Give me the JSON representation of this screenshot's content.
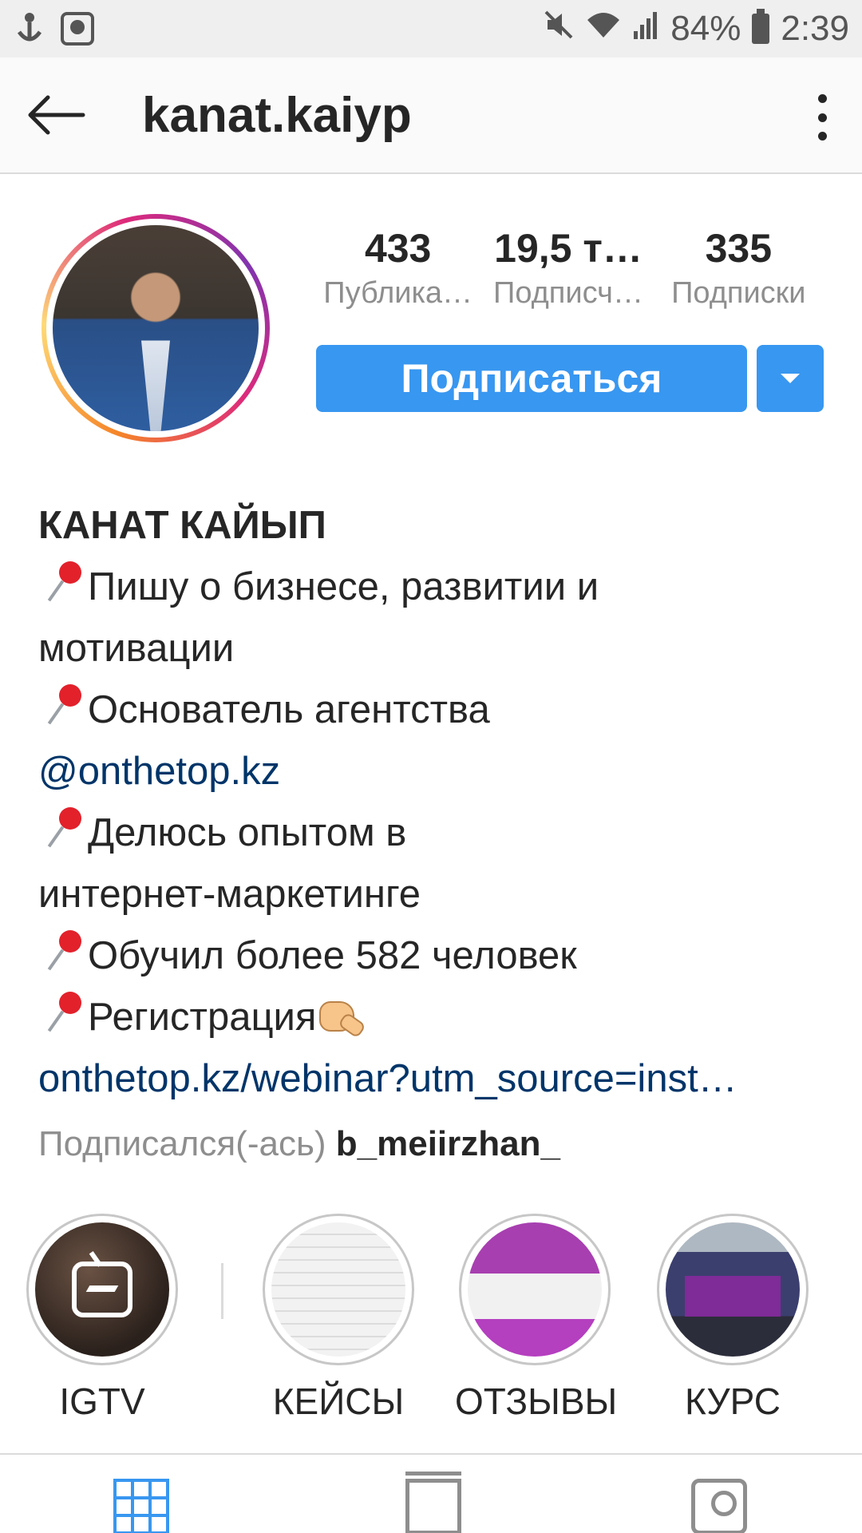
{
  "status_bar": {
    "battery": "84%",
    "time": "2:39",
    "icons": [
      "anchor-icon",
      "download-icon",
      "mute-icon",
      "wifi-icon",
      "signal-icon",
      "battery-icon"
    ]
  },
  "header": {
    "username": "kanat.kaiyp"
  },
  "stats": {
    "posts_value": "433",
    "posts_label": "Публика…",
    "followers_value": "19,5 т…",
    "followers_label": "Подписч…",
    "following_value": "335",
    "following_label": "Подписки"
  },
  "actions": {
    "follow_label": "Подписаться"
  },
  "bio": {
    "full_name": "КАНАТ КАЙЫП",
    "line1": "Пишу о бизнесе, развитии и",
    "line2": "мотивации",
    "line3": "Основатель агентства",
    "mention": "@onthetop.kz",
    "line4": "Делюсь опытом в",
    "line5": "интернет-маркетинге",
    "line6": "Обучил более 582 человек",
    "line7": "Регистрация",
    "website": "onthetop.kz/webinar?utm_source=inst…",
    "followed_by_prefix": "Подписался(-ась)",
    "followed_by_user": "b_meiirzhan_"
  },
  "highlights": [
    {
      "label": "IGTV"
    },
    {
      "label": "КЕЙСЫ"
    },
    {
      "label": "ОТЗЫВЫ"
    },
    {
      "label": "КУРС"
    }
  ],
  "colors": {
    "accent": "#3897f0",
    "link": "#003569",
    "muted": "#8e8e8e",
    "text": "#262626"
  }
}
